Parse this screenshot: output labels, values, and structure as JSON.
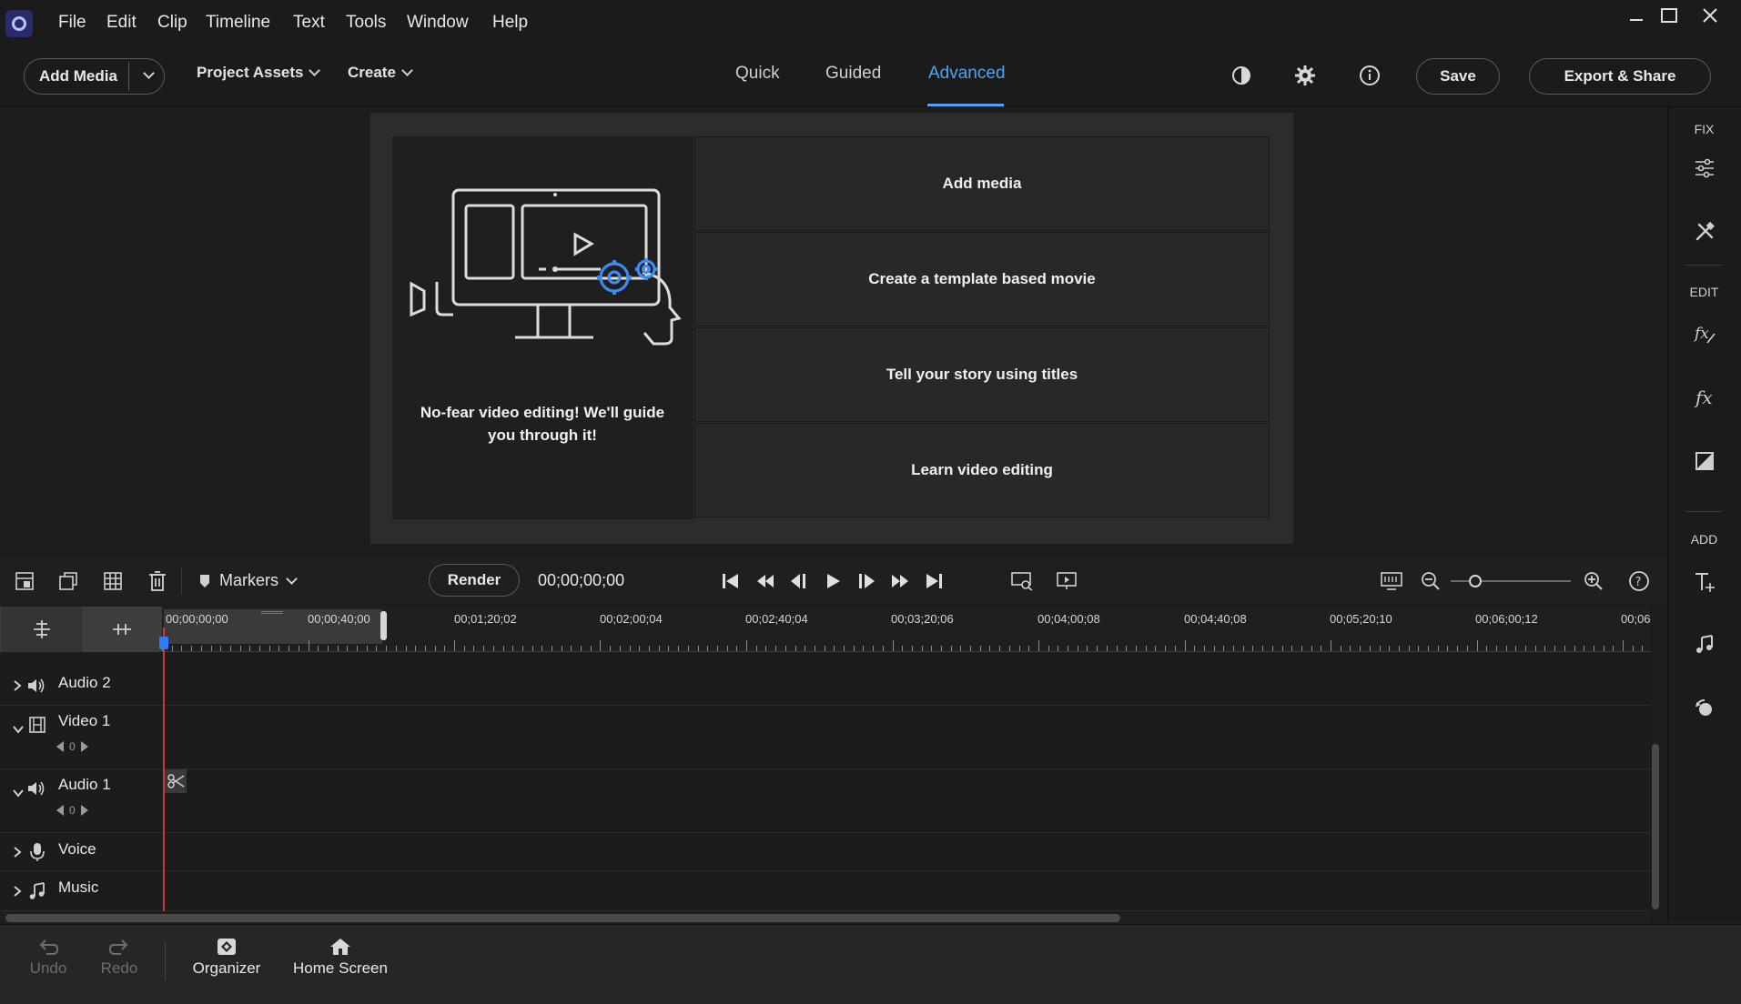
{
  "menubar": {
    "app_icon": "premiere-elements-logo-icon",
    "items": [
      "File",
      "Edit",
      "Clip",
      "Timeline",
      "Text",
      "Tools",
      "Window",
      "Help"
    ],
    "window_controls": [
      "minimize-icon",
      "maximize-icon",
      "close-icon"
    ]
  },
  "toolbar": {
    "add_media": "Add Media",
    "project_assets": "Project Assets",
    "create": "Create",
    "modes": [
      "Quick",
      "Guided",
      "Advanced"
    ],
    "active_mode": "Advanced",
    "save": "Save",
    "export_share": "Export & Share",
    "icons": [
      "theme-contrast-icon",
      "settings-gear-icon",
      "info-icon"
    ]
  },
  "welcome": {
    "tagline": "No-fear video editing! We'll guide you through it!",
    "options": [
      "Add media",
      "Create a template based movie",
      "Tell your story using titles",
      "Learn video editing"
    ]
  },
  "right_panel": {
    "fix_label": "FIX",
    "edit_label": "EDIT",
    "add_label": "ADD",
    "fix_icons": [
      "adjustments-sliders-icon",
      "tools-icon"
    ],
    "edit_icons": [
      "applied-effects-icon",
      "effects-fx-icon",
      "color-icon"
    ],
    "add_icons": [
      "titles-icon",
      "music-icon",
      "graphics-icon"
    ]
  },
  "timeline_toolbar": {
    "markers": "Markers",
    "render": "Render",
    "timecode": "00;00;00;00",
    "zoom_level": 0.0
  },
  "ruler": {
    "timecodes": [
      "00;00;00;00",
      "00;00;40;00",
      "00;01;20;02",
      "00;02;00;04",
      "00;02;40;04",
      "00;03;20;06",
      "00;04;00;08",
      "00;04;40;08",
      "00;05;20;10",
      "00;06;00;12",
      "00;06"
    ]
  },
  "tracks": [
    {
      "name": "Audio 2",
      "type": "audio",
      "expanded": false
    },
    {
      "name": "Video 1",
      "type": "video",
      "expanded": true,
      "control": "0"
    },
    {
      "name": "Audio 1",
      "type": "audio",
      "expanded": true,
      "control": "0"
    },
    {
      "name": "Voice",
      "type": "voice",
      "expanded": false
    },
    {
      "name": "Music",
      "type": "music",
      "expanded": false
    }
  ],
  "bottombar": {
    "undo": "Undo",
    "redo": "Redo",
    "organizer": "Organizer",
    "home_screen": "Home Screen"
  },
  "colors": {
    "accent": "#4fa3f7",
    "playhead": "#c83a3a",
    "background": "#1d1d1d"
  }
}
